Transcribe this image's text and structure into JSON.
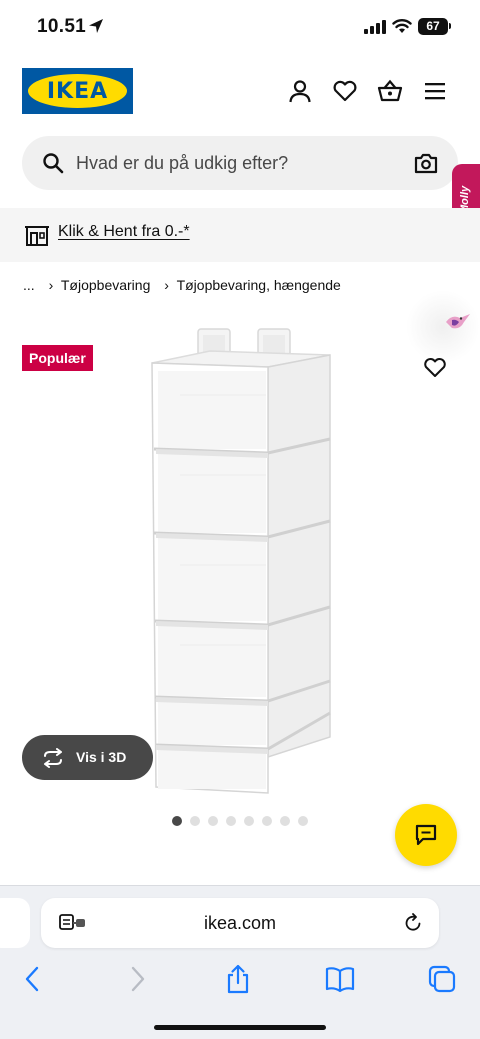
{
  "status_bar": {
    "time": "10.51",
    "battery": "67"
  },
  "header": {
    "logo_text": "IKEA",
    "icons": [
      "user-icon",
      "heart-icon",
      "basket-icon",
      "hamburger-menu-icon"
    ]
  },
  "search": {
    "placeholder": "Hvad er du på udkig efter?"
  },
  "side_tab": {
    "label": "Molly"
  },
  "promo": {
    "link_text": "Klik & Hent fra 0.-*"
  },
  "breadcrumb": {
    "ellipsis": "...",
    "items": [
      "Tøjopbevaring",
      "Tøjopbevaring, hængende"
    ]
  },
  "product": {
    "badge": "Populær",
    "view_3d_label": "Vis i 3D",
    "carousel_count": 8,
    "carousel_active_index": 0
  },
  "browser": {
    "url": "ikea.com"
  },
  "colors": {
    "ikea_blue": "#0058a3",
    "ikea_yellow": "#ffdb00",
    "badge_red": "#cc0044",
    "molly_magenta": "#c2185b",
    "ios_blue": "#1a7aff"
  }
}
